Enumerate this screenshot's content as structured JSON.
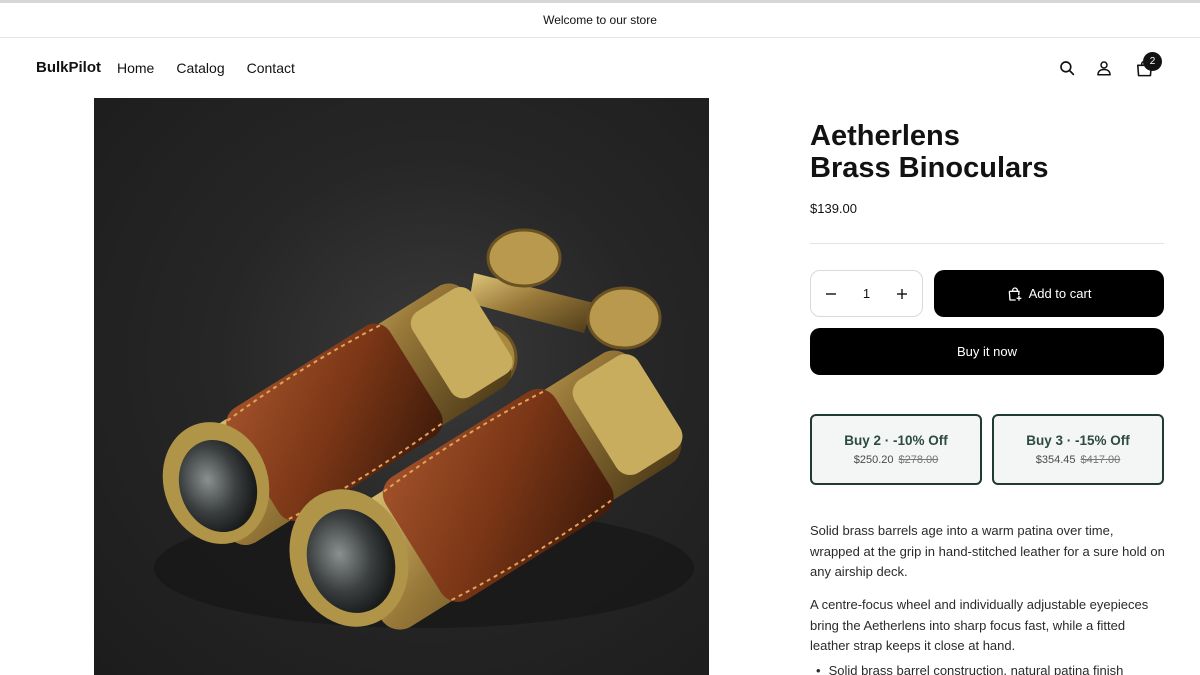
{
  "announcement": {
    "text": "Welcome to our store"
  },
  "header": {
    "logo": "BulkPilot",
    "nav": [
      {
        "label": "Home"
      },
      {
        "label": "Catalog"
      },
      {
        "label": "Contact"
      }
    ],
    "cart_count": "2",
    "icons": [
      "search-icon",
      "account-icon",
      "cart-icon"
    ]
  },
  "product": {
    "title_line1": "Aetherlens",
    "title_line2": "Brass Binoculars",
    "price": "$139.00",
    "quantity": "1",
    "add_to_cart_label": "Add to cart",
    "buy_now_label": "Buy it now",
    "bundles": [
      {
        "label": "Buy 2 · -10% Off",
        "price": "$250.20",
        "compare_price": "$278.00"
      },
      {
        "label": "Buy 3 · -15% Off",
        "price": "$354.45",
        "compare_price": "$417.00"
      }
    ],
    "description": [
      "Solid brass barrels age into a warm patina over time, wrapped at the grip in hand-stitched leather for a sure hold on any airship deck.",
      "A centre-focus wheel and individually adjustable eyepieces bring the Aetherlens into sharp focus fast, while a fitted leather strap keeps it close at hand."
    ],
    "bullets": [
      "Solid brass barrel construction, natural patina finish"
    ]
  },
  "colors": {
    "primary_button": "#000000",
    "bundle_border": "#1f3b32",
    "bundle_bg": "#f3f6f5",
    "bundle_text": "#2d4a41"
  }
}
